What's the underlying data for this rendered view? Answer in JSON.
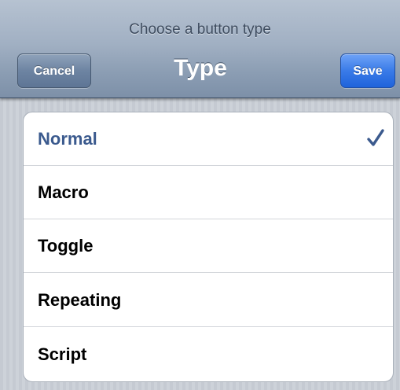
{
  "navbar": {
    "prompt": "Choose a button type",
    "title": "Type",
    "cancel_label": "Cancel",
    "save_label": "Save"
  },
  "options": [
    {
      "label": "Normal",
      "selected": true
    },
    {
      "label": "Macro",
      "selected": false
    },
    {
      "label": "Toggle",
      "selected": false
    },
    {
      "label": "Repeating",
      "selected": false
    },
    {
      "label": "Script",
      "selected": false
    }
  ],
  "colors": {
    "selected_text": "#3b5a8e",
    "checkmark": "#3b5a8e",
    "save_button": "#3a7be8",
    "navbar": "#a1b0c3"
  },
  "icons": {
    "checkmark": "checkmark-icon"
  }
}
